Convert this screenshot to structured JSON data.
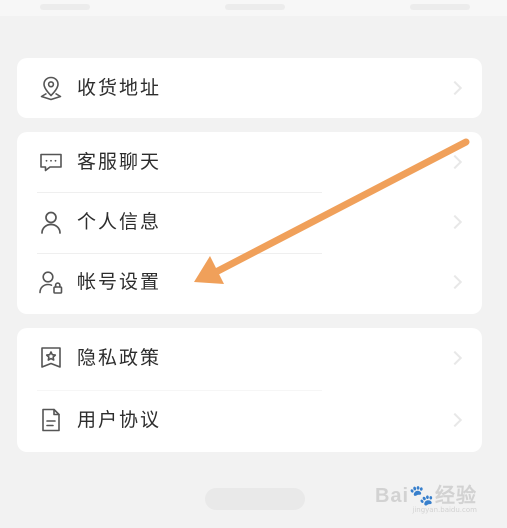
{
  "menu": {
    "groups": [
      {
        "items": [
          {
            "label": "收货地址",
            "icon": "location-pin-icon"
          }
        ]
      },
      {
        "items": [
          {
            "label": "客服聊天",
            "icon": "chat-bubble-icon"
          },
          {
            "label": "个人信息",
            "icon": "person-icon"
          },
          {
            "label": "帐号设置",
            "icon": "person-lock-icon"
          }
        ]
      },
      {
        "items": [
          {
            "label": "隐私政策",
            "icon": "shield-star-icon"
          },
          {
            "label": "用户协议",
            "icon": "document-icon"
          }
        ]
      }
    ]
  },
  "annotation": {
    "color": "#f0a05a",
    "icon": "arrow-annotation-icon"
  },
  "watermark": {
    "logo": "Bai",
    "logo_suffix": "经验",
    "sub": "jingyan.baidu.com"
  }
}
